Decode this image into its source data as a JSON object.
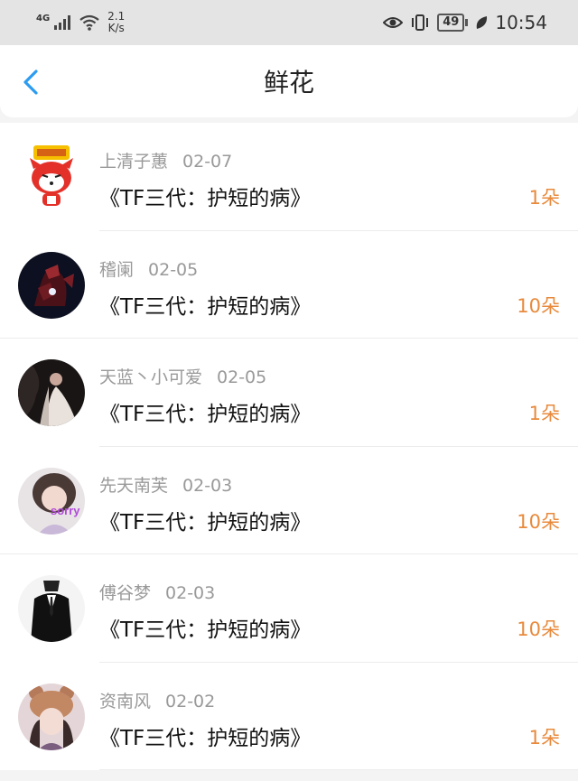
{
  "status_bar": {
    "network_label": "4G",
    "speed_value": "2.1",
    "speed_unit": "K/s",
    "battery": "49",
    "time": "10:54"
  },
  "header": {
    "title": "鲜花",
    "back_icon": "chevron-left-icon",
    "accent_color": "#2b9cf0"
  },
  "items": [
    {
      "name": "上清子蕙",
      "date": "02-07",
      "book": "《TF三代：护短的病》",
      "count": "1朵"
    },
    {
      "name": "稽阑",
      "date": "02-05",
      "book": "《TF三代：护短的病》",
      "count": "10朵"
    },
    {
      "name": "天蓝丶小可爱",
      "date": "02-05",
      "book": "《TF三代：护短的病》",
      "count": "1朵"
    },
    {
      "name": "先天南芙",
      "date": "02-03",
      "book": "《TF三代：护短的病》",
      "count": "10朵"
    },
    {
      "name": "傅谷梦",
      "date": "02-03",
      "book": "《TF三代：护短的病》",
      "count": "10朵"
    },
    {
      "name": "资南风",
      "date": "02-02",
      "book": "《TF三代：护短的病》",
      "count": "1朵"
    }
  ],
  "avatar_texts": {
    "sorry": "sorry"
  },
  "colors": {
    "count": "#e88a3c",
    "meta": "#999999"
  }
}
